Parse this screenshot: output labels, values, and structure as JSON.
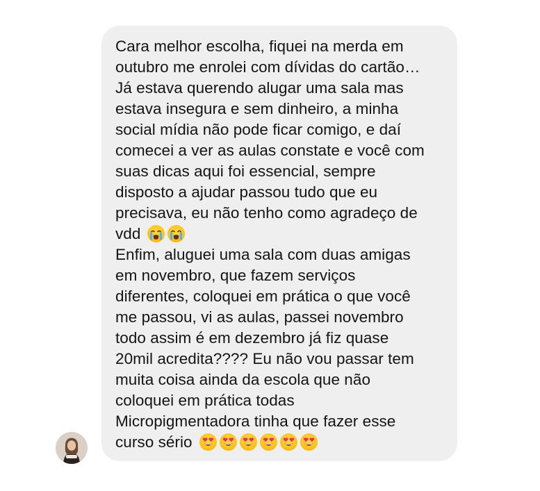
{
  "message": {
    "lines": [
      "Cara melhor escolha, fiquei na merda em",
      "outubro me enrolei com dívidas do cartão…",
      "Já estava querendo alugar uma sala mas",
      "estava insegura e sem dinheiro, a minha",
      "social mídia não pode ficar comigo, e daí",
      "comecei a ver as aulas constate e você com",
      "suas dicas aqui foi essencial, sempre",
      "disposto a ajudar passou tudo que eu",
      "precisava, eu não tenho como agradeço de",
      "vdd",
      "Enfim, aluguei uma sala com duas amigas",
      "em novembro, que fazem serviços",
      "diferentes, coloquei em prática o que você",
      "me passou, vi as aulas, passei novembro",
      "todo assim é em dezembro já fiz quase",
      "20mil acredita???? Eu não vou passar tem",
      "muita coisa ainda da escola que não",
      "coloquei em prática todas",
      "Micropigmentadora tinha que fazer esse",
      "curso sério"
    ],
    "emoji_after_vdd": [
      "loudly-crying-face",
      "loudly-crying-face"
    ],
    "emoji_after_curso_serio": [
      "heart-eyes-face",
      "heart-eyes-face",
      "heart-eyes-face",
      "heart-eyes-face",
      "heart-eyes-face",
      "heart-eyes-face"
    ],
    "bubble_color": "#efeff0",
    "text_color": "#141414"
  },
  "sender": {
    "avatar_icon": "user-avatar-photo"
  }
}
